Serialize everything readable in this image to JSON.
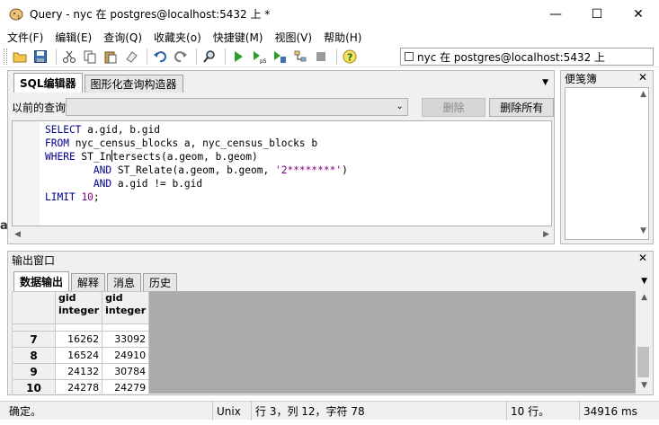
{
  "window": {
    "title": "Query - nyc 在  postgres@localhost:5432 上 *",
    "minimize_glyph": "—",
    "maximize_glyph": "☐",
    "close_glyph": "✕"
  },
  "menu": [
    "文件(F)",
    "编辑(E)",
    "查询(Q)",
    "收藏夹(o)",
    "快捷键(M)",
    "视图(V)",
    "帮助(H)"
  ],
  "toolbar": {
    "connection_label": "nyc 在  postgres@localhost:5432 上",
    "icons": [
      "open-file-icon",
      "save-icon",
      "cut-icon",
      "copy-icon",
      "paste-icon",
      "clear-icon",
      "undo-icon",
      "redo-icon",
      "find-icon",
      "execute-icon",
      "execute-pgscript-icon",
      "execute-to-file-icon",
      "explain-icon",
      "cancel-icon",
      "help-icon"
    ]
  },
  "editor": {
    "tabs": [
      "SQL编辑器",
      "图形化查询构造器"
    ],
    "active_tab": 0,
    "previous_label": "以前的查询",
    "delete_label": "删除",
    "delete_all_label": "删除所有",
    "lines": [
      [
        {
          "t": "SELECT",
          "c": "kw"
        },
        {
          "t": " a.gid, b.gid",
          "c": ""
        }
      ],
      [
        {
          "t": "FROM",
          "c": "kw"
        },
        {
          "t": " nyc_census_blocks a, nyc_census_blocks b",
          "c": ""
        }
      ],
      [
        {
          "t": "WHERE",
          "c": "kw"
        },
        {
          "t": " ST_In",
          "c": ""
        },
        {
          "t": "|",
          "c": "caret"
        },
        {
          "t": "tersects(a.geom, b.geom)",
          "c": ""
        }
      ],
      [
        {
          "t": "        ",
          "c": ""
        },
        {
          "t": "AND",
          "c": "kw"
        },
        {
          "t": " ST_Relate(a.geom, b.geom, ",
          "c": ""
        },
        {
          "t": "'2********'",
          "c": "str"
        },
        {
          "t": ")",
          "c": ""
        }
      ],
      [
        {
          "t": "        ",
          "c": ""
        },
        {
          "t": "AND",
          "c": "kw"
        },
        {
          "t": " a.gid != b.gid",
          "c": ""
        }
      ],
      [
        {
          "t": "LIMIT",
          "c": "kw"
        },
        {
          "t": " ",
          "c": ""
        },
        {
          "t": "10",
          "c": "num"
        },
        {
          "t": ";",
          "c": ""
        }
      ]
    ]
  },
  "scratch_pad": {
    "title": "便笺簿",
    "close_glyph": "✕"
  },
  "output": {
    "title": "输出窗口",
    "close_glyph": "✕",
    "tabs": [
      "数据输出",
      "解释",
      "消息",
      "历史"
    ],
    "active_tab": 0,
    "columns": [
      {
        "name": "gid",
        "type": "integer"
      },
      {
        "name": "gid",
        "type": "integer"
      }
    ],
    "rows": [
      {
        "num": "7",
        "values": [
          "16262",
          "33092"
        ]
      },
      {
        "num": "8",
        "values": [
          "16524",
          "24910"
        ]
      },
      {
        "num": "9",
        "values": [
          "24132",
          "30784"
        ]
      },
      {
        "num": "10",
        "values": [
          "24278",
          "24279"
        ]
      }
    ]
  },
  "status": {
    "message": "确定。",
    "line_endings": "Unix",
    "position": "行 3，列 12，字符 78",
    "row_count": "10 行。",
    "elapsed": "34916 ms"
  }
}
